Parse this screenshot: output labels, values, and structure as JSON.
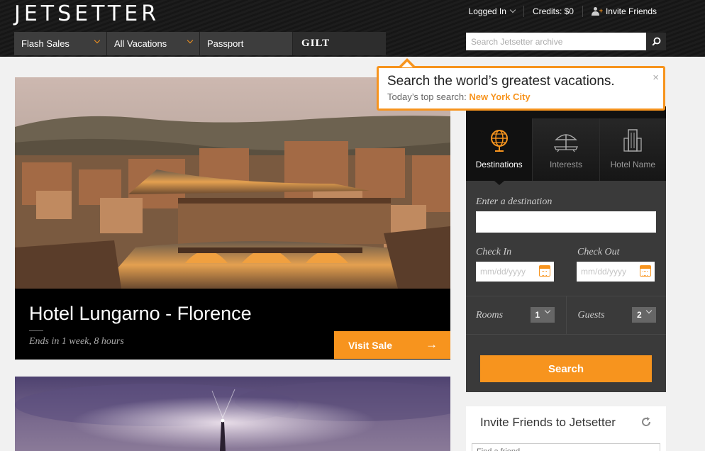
{
  "brand": {
    "logo": "JETSETTER",
    "accent": "#f7941e"
  },
  "user_nav": {
    "logged_in": "Logged In",
    "credits": "Credits: $0",
    "invite": "Invite Friends"
  },
  "main_nav": {
    "flash_sales": "Flash Sales",
    "all_vacations": "All Vacations",
    "passport": "Passport",
    "gilt": "GILT"
  },
  "search": {
    "placeholder": "Search Jetsetter archive"
  },
  "tooltip": {
    "title": "Search the world’s greatest vacations.",
    "prefix": "Today’s top search:",
    "city": "New York City",
    "close": "×"
  },
  "listing": {
    "title": "Hotel Lungarno - Florence",
    "ends": "Ends in 1 week, 8 hours",
    "visit_label": "Visit Sale",
    "visit_arrow": "→"
  },
  "panel": {
    "tabs": [
      {
        "label": "Destinations",
        "icon": "globe-icon"
      },
      {
        "label": "Interests",
        "icon": "beach-umbrella-icon"
      },
      {
        "label": "Hotel Name",
        "icon": "building-icon"
      }
    ],
    "dest_label": "Enter a destination",
    "checkin_label": "Check In",
    "checkout_label": "Check Out",
    "date_placeholder": "mm/dd/yyyy",
    "rooms_label": "Rooms",
    "rooms_value": "1",
    "guests_label": "Guests",
    "guests_value": "2",
    "submit": "Search"
  },
  "invite": {
    "title": "Invite Friends to Jetsetter",
    "placeholder": "Find a friend"
  }
}
